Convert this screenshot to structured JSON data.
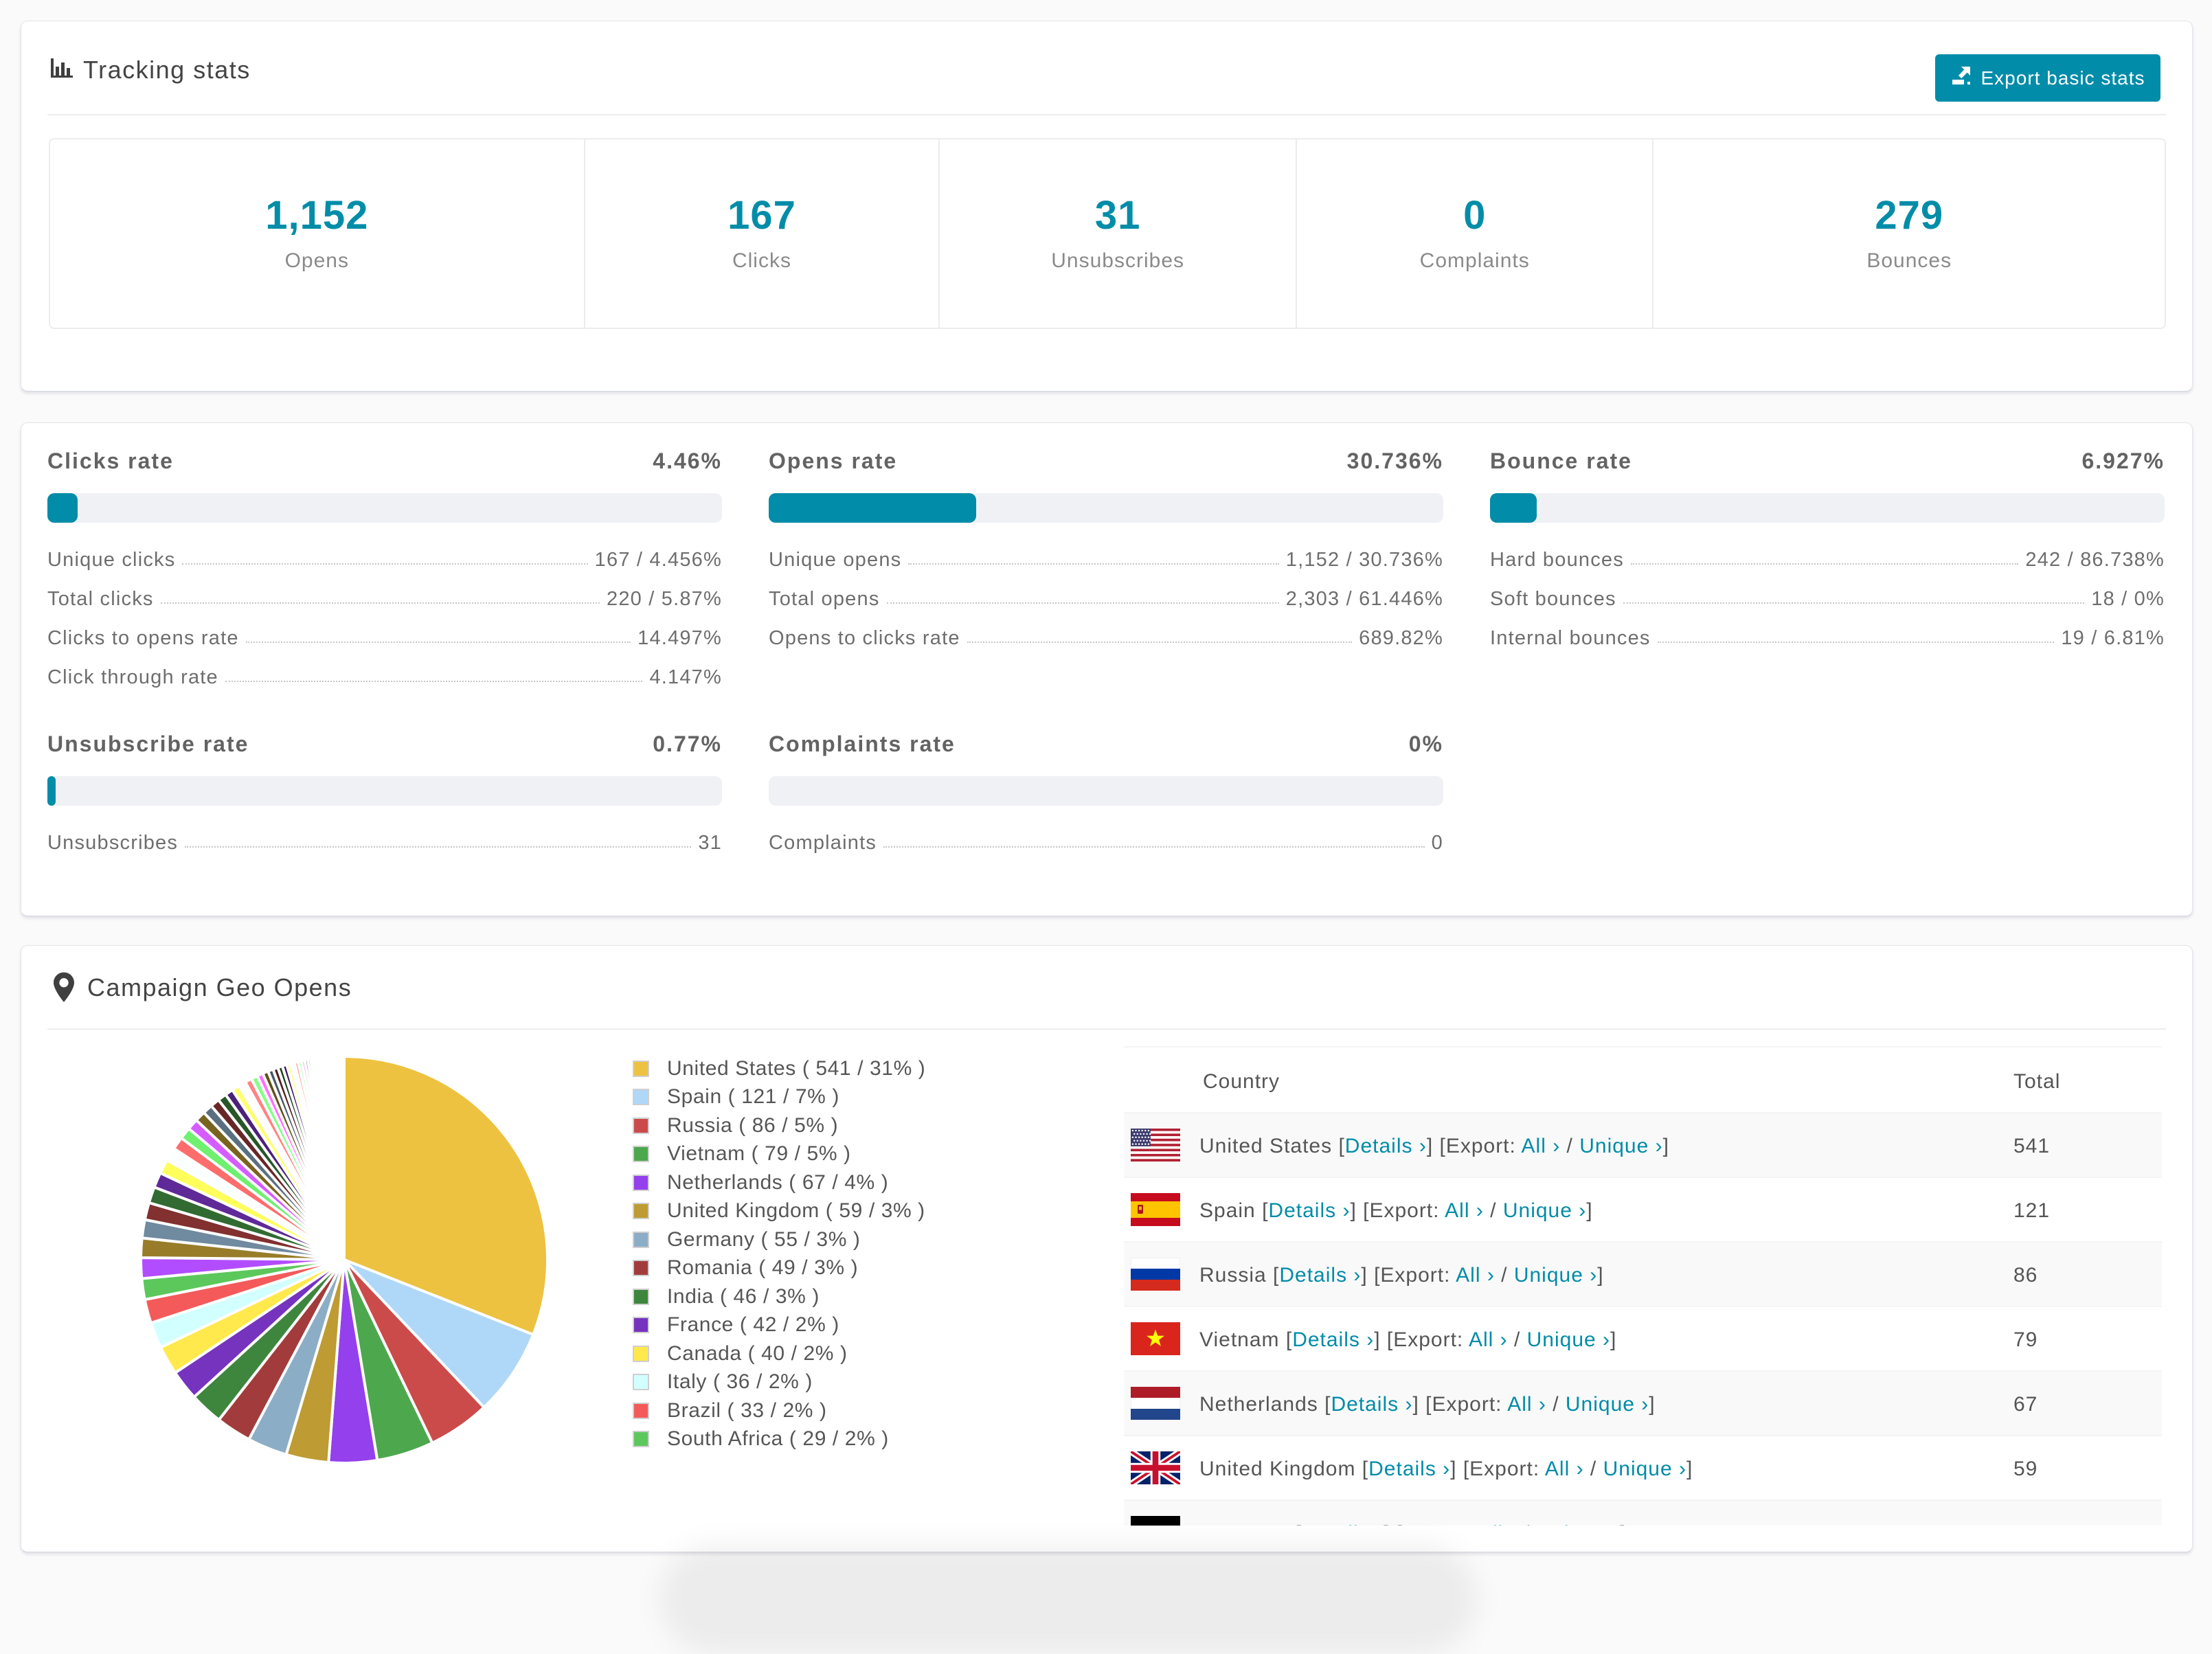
{
  "accent_color": "#018ca9",
  "tracking": {
    "title": "Tracking stats",
    "export_button": "Export basic stats",
    "stats": [
      {
        "value": "1,152",
        "label": "Opens"
      },
      {
        "value": "167",
        "label": "Clicks"
      },
      {
        "value": "31",
        "label": "Unsubscribes"
      },
      {
        "value": "0",
        "label": "Complaints"
      },
      {
        "value": "279",
        "label": "Bounces"
      }
    ]
  },
  "rates": {
    "sections": [
      {
        "id": "clicks-rate",
        "title": "Clicks rate",
        "value": "4.46%",
        "pct": 4.46,
        "col": 0,
        "row": 0,
        "rows": [
          {
            "label": "Unique clicks",
            "value": "167 / 4.456%"
          },
          {
            "label": "Total clicks",
            "value": "220 / 5.87%"
          },
          {
            "label": "Clicks to opens rate",
            "value": "14.497%"
          },
          {
            "label": "Click through rate",
            "value": "4.147%"
          }
        ]
      },
      {
        "id": "opens-rate",
        "title": "Opens rate",
        "value": "30.736%",
        "pct": 30.736,
        "col": 1,
        "row": 0,
        "rows": [
          {
            "label": "Unique opens",
            "value": "1,152 / 30.736%"
          },
          {
            "label": "Total opens",
            "value": "2,303 / 61.446%"
          },
          {
            "label": "Opens to clicks rate",
            "value": "689.82%"
          }
        ]
      },
      {
        "id": "bounce-rate",
        "title": "Bounce rate",
        "value": "6.927%",
        "pct": 6.927,
        "col": 2,
        "row": 0,
        "rows": [
          {
            "label": "Hard bounces",
            "value": "242 / 86.738%"
          },
          {
            "label": "Soft bounces",
            "value": "18 / 0%"
          },
          {
            "label": "Internal bounces",
            "value": "19 / 6.81%"
          }
        ]
      },
      {
        "id": "unsubscribe-rate",
        "title": "Unsubscribe rate",
        "value": "0.77%",
        "pct": 0.77,
        "col": 0,
        "row": 1,
        "rows": [
          {
            "label": "Unsubscribes",
            "value": "31"
          }
        ]
      },
      {
        "id": "complaints-rate",
        "title": "Complaints rate",
        "value": "0%",
        "pct": 0,
        "col": 1,
        "row": 1,
        "rows": [
          {
            "label": "Complaints",
            "value": "0"
          }
        ]
      }
    ]
  },
  "geo": {
    "title": "Campaign Geo Opens",
    "table": {
      "columns": [
        "Country",
        "Total"
      ],
      "link_labels": {
        "details": "Details ›",
        "export": "[Export:",
        "all": "All ›",
        "sep": "/",
        "unique": "Unique ›"
      },
      "rows": [
        {
          "country": "United States",
          "flag": "us",
          "total": "541"
        },
        {
          "country": "Spain",
          "flag": "es",
          "total": "121"
        },
        {
          "country": "Russia",
          "flag": "ru",
          "total": "86"
        },
        {
          "country": "Vietnam",
          "flag": "vn",
          "total": "79"
        },
        {
          "country": "Netherlands",
          "flag": "nl",
          "total": "67"
        },
        {
          "country": "United Kingdom",
          "flag": "gb",
          "total": "59"
        },
        {
          "country": "Germany",
          "flag": "de",
          "total": ""
        }
      ]
    }
  },
  "chart_data": {
    "type": "pie",
    "title": "Campaign Geo Opens",
    "legend_position": "right",
    "categories": [
      "United States",
      "Spain",
      "Russia",
      "Vietnam",
      "Netherlands",
      "United Kingdom",
      "Germany",
      "Romania",
      "India",
      "France",
      "Canada",
      "Italy",
      "Brazil",
      "South Africa"
    ],
    "values": [
      541,
      121,
      86,
      79,
      67,
      59,
      55,
      49,
      46,
      42,
      40,
      36,
      33,
      29
    ],
    "percent_labels": [
      31,
      7,
      5,
      5,
      4,
      3,
      3,
      3,
      3,
      2,
      2,
      2,
      2,
      2
    ],
    "others_pct": 26.48,
    "others_slice_count": 55,
    "palette_base": [
      "#edc240",
      "#afd8f8",
      "#cb4b4b",
      "#4da74d",
      "#9440ed"
    ],
    "legend_labels": [
      "United States ( 541 / 31% )",
      "Spain ( 121 / 7% )",
      "Russia ( 86 / 5% )",
      "Vietnam ( 79 / 5% )",
      "Netherlands ( 67 / 4% )",
      "United Kingdom ( 59 / 3% )",
      "Germany ( 55 / 3% )",
      "Romania ( 49 / 3% )",
      "India ( 46 / 3% )",
      "France ( 42 / 2% )",
      "Canada ( 40 / 2% )",
      "Italy ( 36 / 2% )",
      "Brazil ( 33 / 2% )",
      "South Africa ( 29 / 2% )"
    ]
  }
}
